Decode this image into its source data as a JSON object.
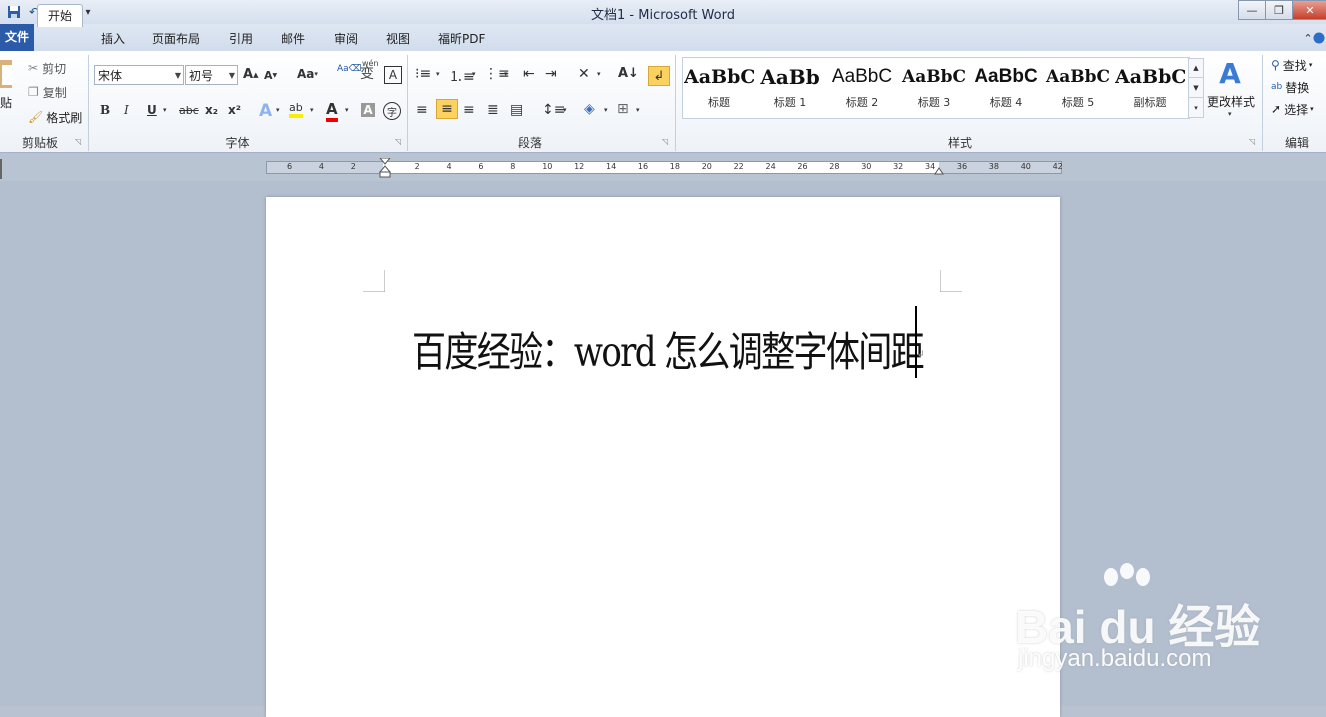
{
  "window": {
    "title": "文档1  -  Microsoft Word",
    "min": "—",
    "restore": "❐",
    "close": "✕"
  },
  "qat": {
    "save_icon": "save-icon",
    "undo_icon": "undo-icon",
    "redo_icon": "redo-icon"
  },
  "tabs": {
    "file": "文件",
    "items": [
      "开始",
      "插入",
      "页面布局",
      "引用",
      "邮件",
      "审阅",
      "视图",
      "福昕PDF"
    ],
    "active": "开始"
  },
  "clipboard": {
    "paste": "贴",
    "cut": "剪切",
    "copy": "复制",
    "format_painter": "格式刷",
    "label": "剪贴板"
  },
  "font": {
    "family": "宋体",
    "size": "初号",
    "grow": "A",
    "shrink": "A",
    "case": "Aa",
    "wen": "wén",
    "bian": "变",
    "A_border": "A",
    "bold": "B",
    "italic": "I",
    "underline": "U",
    "strike": "abc",
    "sub": "x₂",
    "sup": "x²",
    "text_effect": "A",
    "highlight": "ab",
    "font_color": "A",
    "char_shade": "A",
    "char_circle": "字",
    "label": "字体"
  },
  "paragraph": {
    "label": "段落"
  },
  "styles": {
    "items": [
      {
        "sample": "AaBbC",
        "name": "标题"
      },
      {
        "sample": "AaBb",
        "name": "标题 1"
      },
      {
        "sample": "AaBbC",
        "name": "标题 2"
      },
      {
        "sample": "AaBbC",
        "name": "标题 3"
      },
      {
        "sample": "AaBbC",
        "name": "标题 4"
      },
      {
        "sample": "AaBbC",
        "name": "标题 5"
      },
      {
        "sample": "AaBbC",
        "name": "副标题"
      }
    ],
    "change_styles": "更改样式",
    "label": "样式"
  },
  "editing": {
    "find": "查找",
    "replace": "替换",
    "select": "选择",
    "label": "编辑"
  },
  "ruler": {
    "numbers": [
      "6",
      "4",
      "2",
      "",
      "2",
      "4",
      "6",
      "8",
      "10",
      "12",
      "14",
      "16",
      "18",
      "20",
      "22",
      "24",
      "26",
      "28",
      "30",
      "32",
      "34",
      "36",
      "38",
      "40",
      "42"
    ]
  },
  "document": {
    "text": "百度经验：word 怎么调整字体间距"
  },
  "watermark": {
    "brand": "Bai du 经验",
    "site": "jingyan.baidu.com"
  }
}
